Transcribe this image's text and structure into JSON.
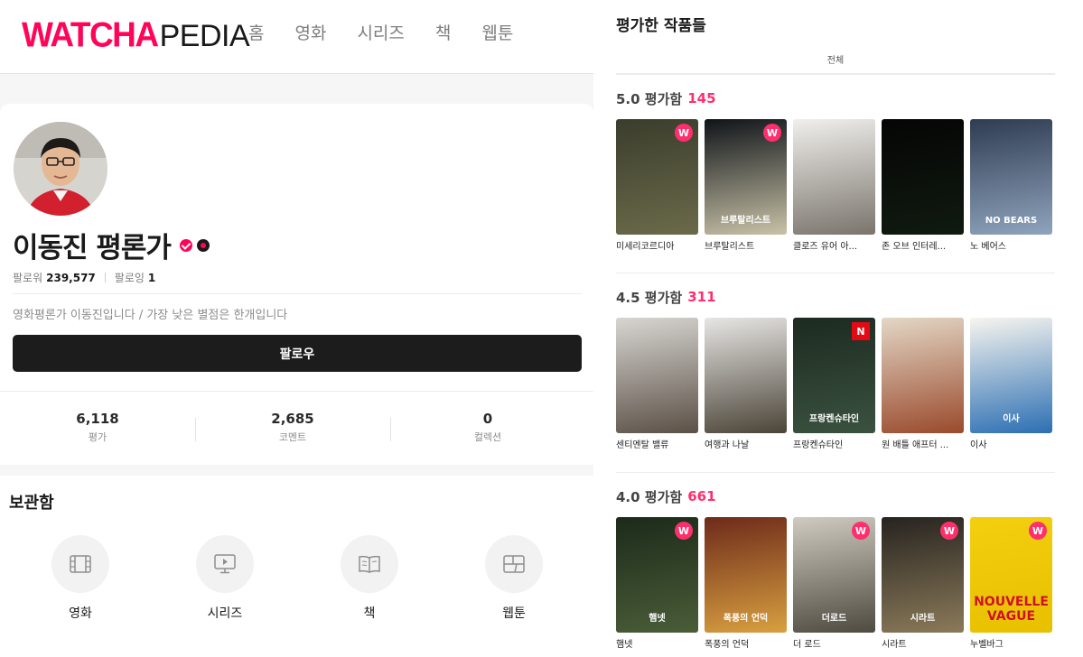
{
  "header": {
    "logo_main": "WATCHA",
    "logo_sub": "PEDIA",
    "nav": [
      "홈",
      "영화",
      "시리즈",
      "책",
      "웹툰"
    ]
  },
  "profile": {
    "name": "이동진 평론가",
    "followers_label": "팔로워",
    "followers_count": "239,577",
    "following_label": "팔로잉",
    "following_count": "1",
    "bio": "영화평론가 이동진입니다 / 가장 낮은 별점은 한개입니다",
    "follow_button": "팔로우",
    "stats": [
      {
        "value": "6,118",
        "label": "평가"
      },
      {
        "value": "2,685",
        "label": "코멘트"
      },
      {
        "value": "0",
        "label": "컬렉션"
      }
    ]
  },
  "storage": {
    "title": "보관함",
    "items": [
      {
        "label": "영화",
        "icon": "film-icon"
      },
      {
        "label": "시리즈",
        "icon": "tv-icon"
      },
      {
        "label": "책",
        "icon": "book-icon"
      },
      {
        "label": "웹툰",
        "icon": "webtoon-icon"
      }
    ]
  },
  "rated": {
    "title": "평가한 작품들",
    "tab_all": "전체",
    "sections": [
      {
        "label": "5.0 평가함",
        "count": "145",
        "movies": [
          {
            "title": "미세리코르디아",
            "badge": "W",
            "colors": [
              "#3a3d2c",
              "#6b6a4a"
            ]
          },
          {
            "title": "브루탈리스트",
            "badge": "W",
            "colors": [
              "#0f1418",
              "#c9c2a8"
            ],
            "poster_text": "브루탈리스트"
          },
          {
            "title": "클로즈 유어 아...",
            "badge": "",
            "colors": [
              "#f0efec",
              "#7a746c"
            ]
          },
          {
            "title": "존 오브 인터레...",
            "badge": "",
            "colors": [
              "#050505",
              "#101a10"
            ]
          },
          {
            "title": "노 베어스",
            "badge": "",
            "colors": [
              "#2f3c52",
              "#8fa4bd"
            ],
            "poster_text": "NO BEARS"
          }
        ]
      },
      {
        "label": "4.5 평가함",
        "count": "311",
        "movies": [
          {
            "title": "센티멘탈 밸류",
            "badge": "",
            "colors": [
              "#d8d6d2",
              "#5b5046"
            ]
          },
          {
            "title": "여행과 나날",
            "badge": "",
            "colors": [
              "#e7e6e4",
              "#4b4438"
            ]
          },
          {
            "title": "프랑켄슈타인",
            "badge": "N",
            "colors": [
              "#1c2a20",
              "#3b5240"
            ],
            "poster_text": "프랑켄슈타인"
          },
          {
            "title": "원 배틀 애프터 ...",
            "badge": "",
            "colors": [
              "#e3d7c6",
              "#9a4a2c"
            ]
          },
          {
            "title": "이사",
            "badge": "",
            "colors": [
              "#f7f5ef",
              "#2c6fb3"
            ],
            "poster_text": "이사"
          }
        ]
      },
      {
        "label": "4.0 평가함",
        "count": "661",
        "movies": [
          {
            "title": "햄넷",
            "badge": "W",
            "colors": [
              "#1c2a1a",
              "#4a5d38"
            ],
            "poster_text": "햄넷"
          },
          {
            "title": "폭풍의 언덕",
            "badge": "",
            "colors": [
              "#6e2a1a",
              "#d8a040"
            ],
            "poster_text": "폭풍의 언덕"
          },
          {
            "title": "더 로드",
            "badge": "W",
            "colors": [
              "#cfcbc1",
              "#4f4a40"
            ],
            "poster_text": "더로드"
          },
          {
            "title": "시라트",
            "badge": "W",
            "colors": [
              "#26231f",
              "#8b7a5a"
            ],
            "poster_text": "시라트"
          },
          {
            "title": "누벨바그",
            "badge": "W",
            "colors": [
              "#f2cf10",
              "#e8c000"
            ],
            "poster_text": "NOUVELLE VAGUE"
          }
        ]
      }
    ]
  }
}
